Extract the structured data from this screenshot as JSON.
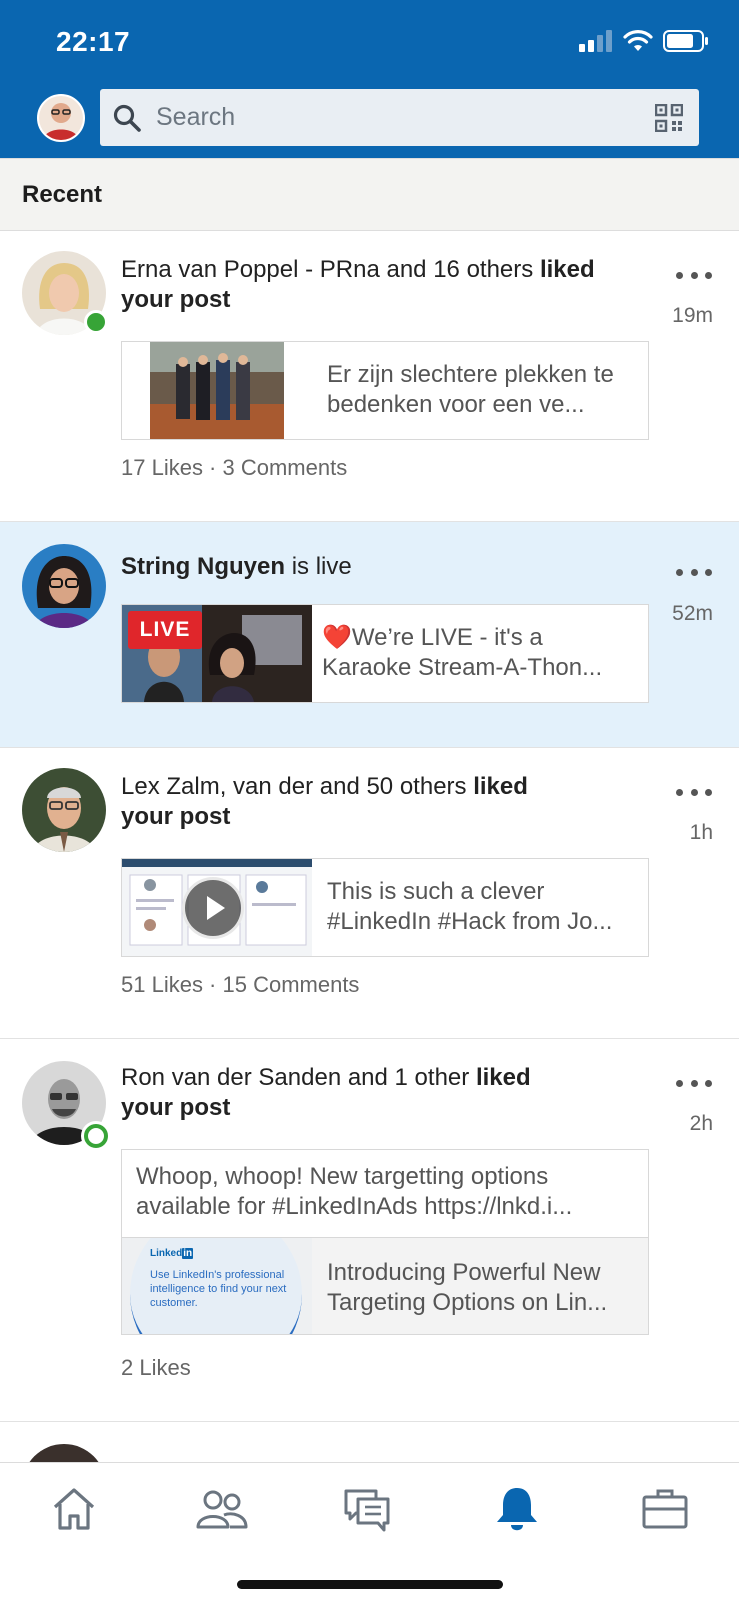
{
  "status_bar": {
    "time": "22:17"
  },
  "search": {
    "placeholder": "Search"
  },
  "section": {
    "title": "Recent"
  },
  "notifications": [
    {
      "actor": "Erna van Poppel - PRna and 16 others",
      "action": "liked",
      "action_tail": "your post",
      "time": "19m",
      "card_text": "Er zijn slechtere plekken te bedenken voor een ve...",
      "stats": "17 Likes · 3 Comments"
    },
    {
      "actor": "String Nguyen",
      "action": "is live",
      "time": "52m",
      "live_badge": "LIVE",
      "card_emoji": "❤️",
      "card_text": "We’re LIVE - it's a Karaoke Stream-A-Thon..."
    },
    {
      "actor": "Lex Zalm, van der and 50 others",
      "action": "liked",
      "action_tail": "your post",
      "time": "1h",
      "card_text": "This is such a clever #LinkedIn #Hack from Jo...",
      "stats": "51 Likes · 15 Comments"
    },
    {
      "actor": "Ron van der Sanden and 1 other",
      "action": "liked",
      "action_tail": "your post",
      "time": "2h",
      "post_text": "Whoop, whoop! New targetting options available for #LinkedInAds https://lnkd.i...",
      "card_text": "Introducing Powerful New Targeting Options on Lin...",
      "thumb_brand": "Linked",
      "thumb_brand_in": "in",
      "thumb_text": "Use LinkedIn's professional intelligence to find your next customer.",
      "stats": "2 Likes"
    }
  ],
  "nav": [
    {
      "icon": "home-icon"
    },
    {
      "icon": "my-network-icon"
    },
    {
      "icon": "messaging-icon"
    },
    {
      "icon": "notifications-icon",
      "active": true
    },
    {
      "icon": "jobs-icon"
    }
  ],
  "colors": {
    "brand": "#0a66b0",
    "live_bg": "#e3f1fb",
    "online": "#37a437",
    "live_red": "#e0262b"
  }
}
